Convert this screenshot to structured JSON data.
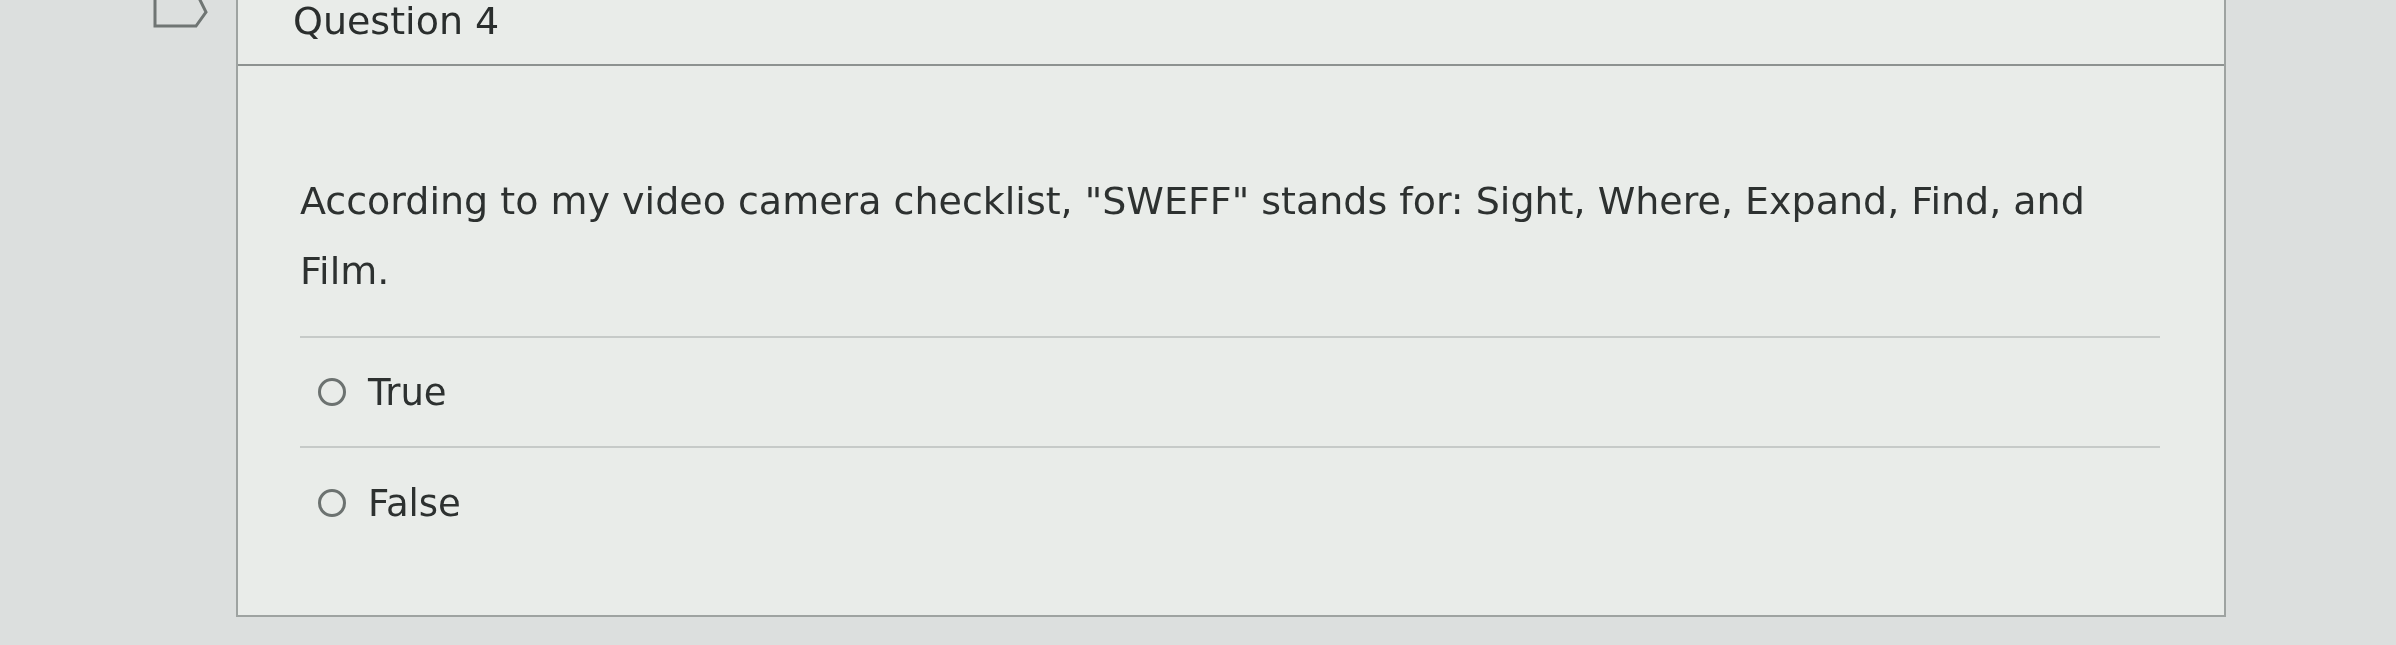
{
  "question": {
    "title": "Question 4",
    "text": "According to my video camera checklist, \"SWEFF\" stands for: Sight, Where, Expand, Find, and  Film.",
    "options": [
      {
        "label": "True",
        "selected": false
      },
      {
        "label": "False",
        "selected": false
      }
    ]
  }
}
